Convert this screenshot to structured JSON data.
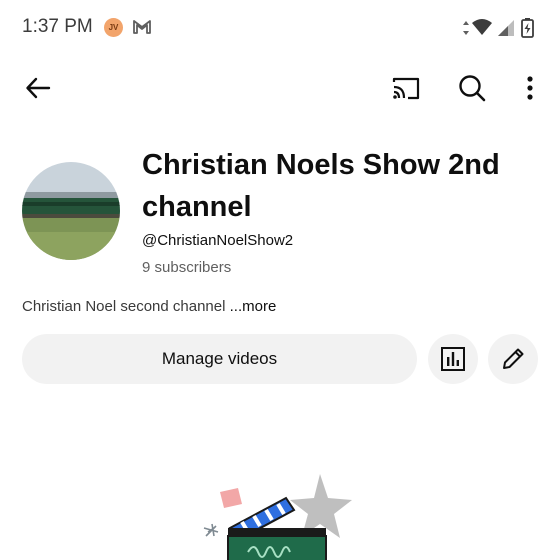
{
  "status_bar": {
    "time": "1:37 PM",
    "avatar_initials": "JV",
    "icons": [
      "gmail-icon",
      "data-arrows-icon",
      "wifi-icon",
      "signal-icon",
      "battery-charging-icon"
    ]
  },
  "app_bar": {
    "icons": [
      "back-arrow-icon",
      "cast-icon",
      "search-icon",
      "more-vert-icon"
    ]
  },
  "channel": {
    "name": "Christian Noels Show 2nd channel",
    "handle": "@ChristianNoelShow2",
    "subscribers": "9 subscribers",
    "description": "Christian Noel second channel",
    "more_label": "...more"
  },
  "actions": {
    "manage_videos_label": "Manage videos",
    "analytics_icon": "analytics-icon",
    "edit_icon": "pencil-icon"
  },
  "colors": {
    "button_bg": "#f2f2f2",
    "text_primary": "#0f0f0f",
    "text_secondary": "#606060",
    "avatar_bg": "#f2a46b"
  }
}
